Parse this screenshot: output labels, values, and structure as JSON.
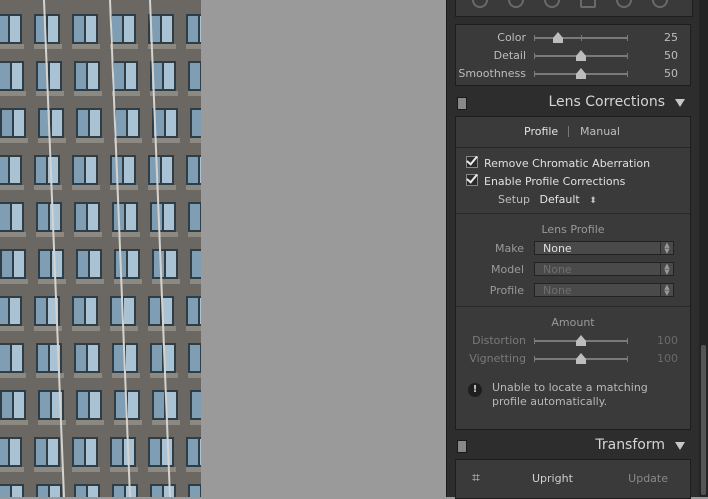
{
  "detail_sliders": [
    {
      "label": "Color",
      "value": "25",
      "fraction": 0.25
    },
    {
      "label": "Detail",
      "value": "50",
      "fraction": 0.5
    },
    {
      "label": "Smoothness",
      "value": "50",
      "fraction": 0.5
    }
  ],
  "lens_corrections": {
    "title": "Lens Corrections",
    "tabs": [
      {
        "label": "Profile",
        "active": true
      },
      {
        "label": "Manual",
        "active": false
      }
    ],
    "checks": [
      {
        "label": "Remove Chromatic Aberration",
        "checked": true
      },
      {
        "label": "Enable Profile Corrections",
        "checked": true
      }
    ],
    "setup_label": "Setup",
    "setup_value": "Default",
    "lens_profile_heading": "Lens Profile",
    "profile_fields": [
      {
        "label": "Make",
        "value": "None",
        "enabled": true
      },
      {
        "label": "Model",
        "value": "None",
        "enabled": false
      },
      {
        "label": "Profile",
        "value": "None",
        "enabled": false
      }
    ],
    "amount_heading": "Amount",
    "amount_sliders": [
      {
        "label": "Distortion",
        "value": "100",
        "fraction": 0.5
      },
      {
        "label": "Vignetting",
        "value": "100",
        "fraction": 0.5
      }
    ],
    "warning": "Unable to locate a matching profile automatically."
  },
  "transform": {
    "title": "Transform",
    "upright_label": "Upright",
    "update_label": "Update"
  },
  "icons": {
    "crop": "crop-icon",
    "warning": "warning-icon",
    "collapse": "triangle-down-icon"
  }
}
